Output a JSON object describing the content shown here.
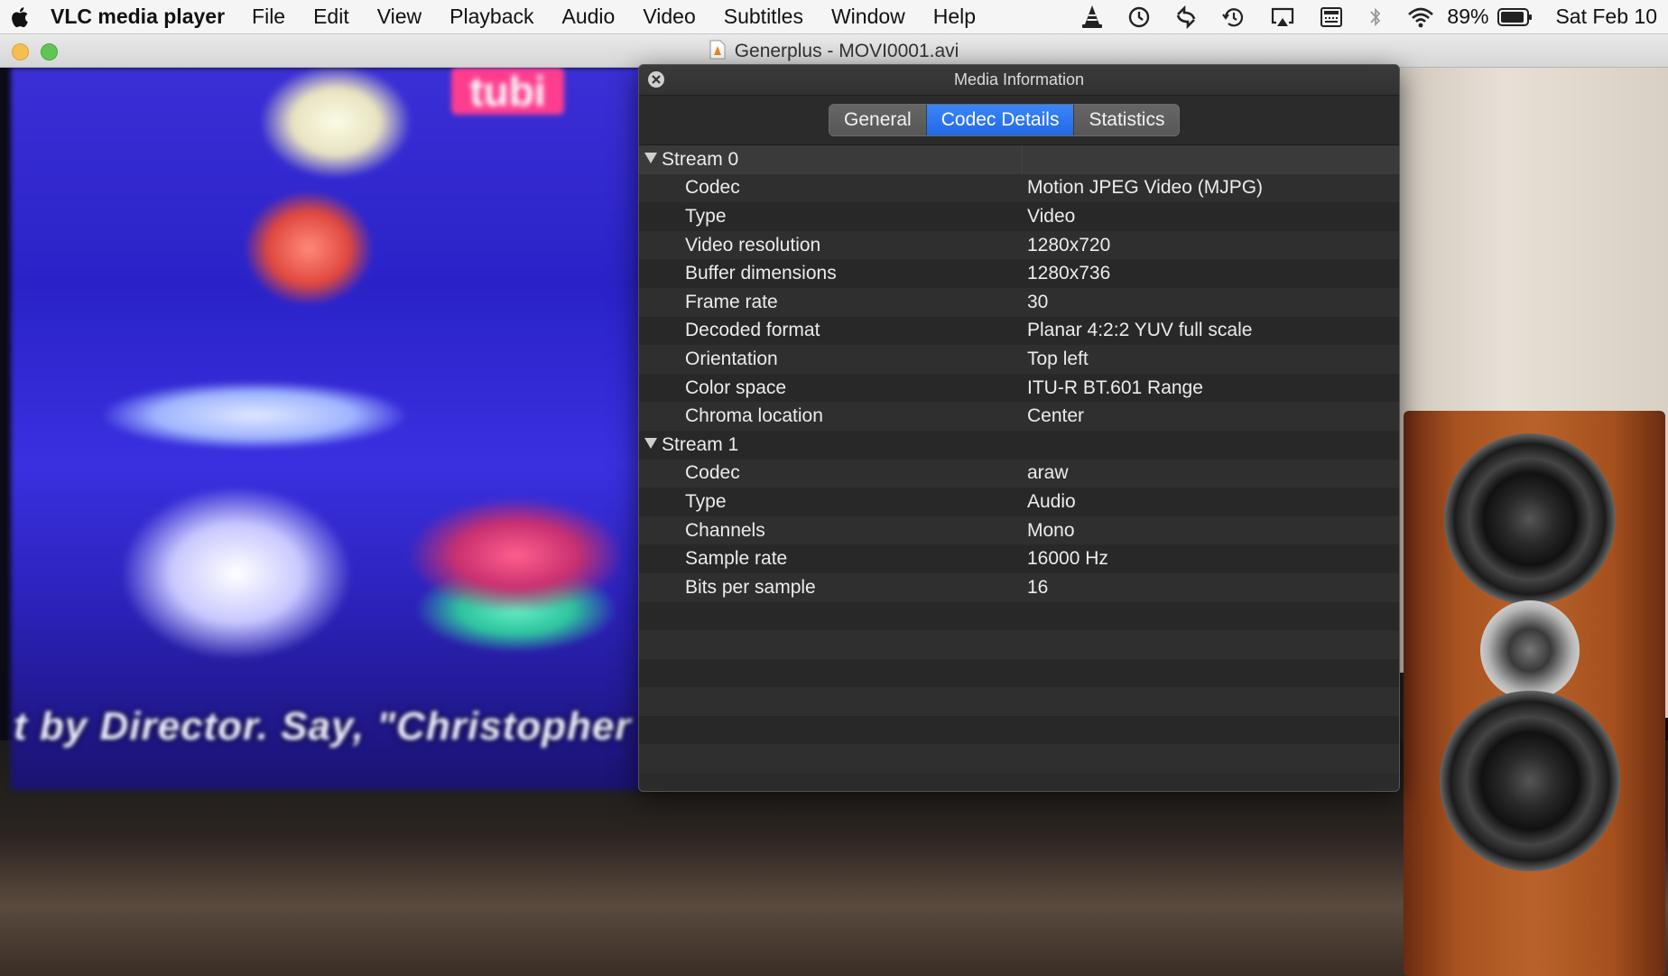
{
  "menubar": {
    "app_name": "VLC media player",
    "items": [
      "File",
      "Edit",
      "View",
      "Playback",
      "Audio",
      "Video",
      "Subtitles",
      "Window",
      "Help"
    ],
    "battery": "89%",
    "date": "Sat Feb 10"
  },
  "window": {
    "title": "Generplus - MOVI0001.avi"
  },
  "video_overlay": {
    "tubi_logo": "tubi",
    "caption": "t by Director. Say, \"Christopher Nol"
  },
  "media_info": {
    "title": "Media Information",
    "tabs": [
      {
        "label": "General",
        "active": false
      },
      {
        "label": "Codec Details",
        "active": true
      },
      {
        "label": "Statistics",
        "active": false
      }
    ],
    "streams": [
      {
        "name": "Stream 0",
        "rows": [
          {
            "key": "Codec",
            "value": "Motion JPEG Video (MJPG)"
          },
          {
            "key": "Type",
            "value": "Video"
          },
          {
            "key": "Video resolution",
            "value": "1280x720"
          },
          {
            "key": "Buffer dimensions",
            "value": "1280x736"
          },
          {
            "key": "Frame rate",
            "value": "30"
          },
          {
            "key": "Decoded format",
            "value": "Planar 4:2:2 YUV full scale"
          },
          {
            "key": "Orientation",
            "value": "Top left"
          },
          {
            "key": "Color space",
            "value": "ITU-R BT.601 Range"
          },
          {
            "key": "Chroma location",
            "value": "Center"
          }
        ]
      },
      {
        "name": "Stream 1",
        "rows": [
          {
            "key": "Codec",
            "value": "araw"
          },
          {
            "key": "Type",
            "value": "Audio"
          },
          {
            "key": "Channels",
            "value": "Mono"
          },
          {
            "key": "Sample rate",
            "value": "16000 Hz"
          },
          {
            "key": "Bits per sample",
            "value": "16"
          }
        ]
      }
    ]
  },
  "colors": {
    "accent_tab": "#2a6ff0",
    "panel_bg": "#2b2b2b"
  }
}
